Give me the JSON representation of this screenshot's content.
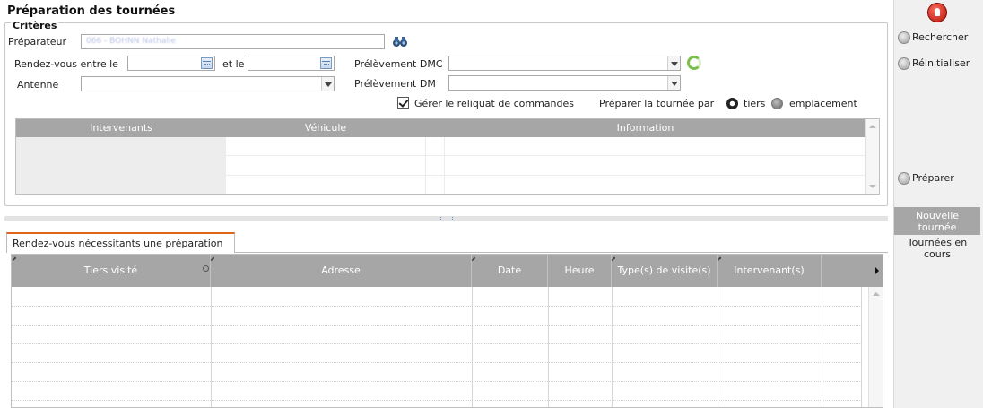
{
  "page_title": "Préparation des tournées",
  "criteria": {
    "legend": "Critères",
    "preparateur_label": "Préparateur",
    "preparateur_value": "066 - BOHNN Nathalie",
    "rdv_between_label": "Rendez-vous entre le",
    "and_label": "et le",
    "date_from": "",
    "date_to": "",
    "antenne_label": "Antenne",
    "antenne_value": "",
    "dmc_label": "Prélèvement DMC",
    "dmc_value": "",
    "dm_label": "Prélèvement DM",
    "dm_value": "",
    "reliquat_label": "Gérer le reliquat de commandes",
    "reliquat_checked": true,
    "prepare_by_label": "Préparer la tournée par",
    "radio_tiers": "tiers",
    "radio_emplacement": "emplacement",
    "selected_radio": "tiers"
  },
  "top_grid": {
    "columns": [
      "Intervenants",
      "Véhicule",
      "Information"
    ]
  },
  "tab": {
    "label": "Rendez-vous nécessitants une préparation"
  },
  "bottom_grid": {
    "columns": [
      "Tiers visité",
      "Adresse",
      "Date",
      "Heure",
      "Type(s) de visite(s)",
      "Intervenant(s)"
    ]
  },
  "sidebar": {
    "rechercher": "Rechercher",
    "reinitialiser": "Réinitialiser",
    "preparer": "Préparer",
    "nav_active_line1": "Nouvelle",
    "nav_active_line2": "tournée",
    "nav_item_line1": "Tournées en",
    "nav_item_line2": "cours"
  },
  "colors": {
    "header_gray": "#a6a6a6",
    "tab_accent": "#e0641a",
    "stop_red": "#c8281a"
  }
}
